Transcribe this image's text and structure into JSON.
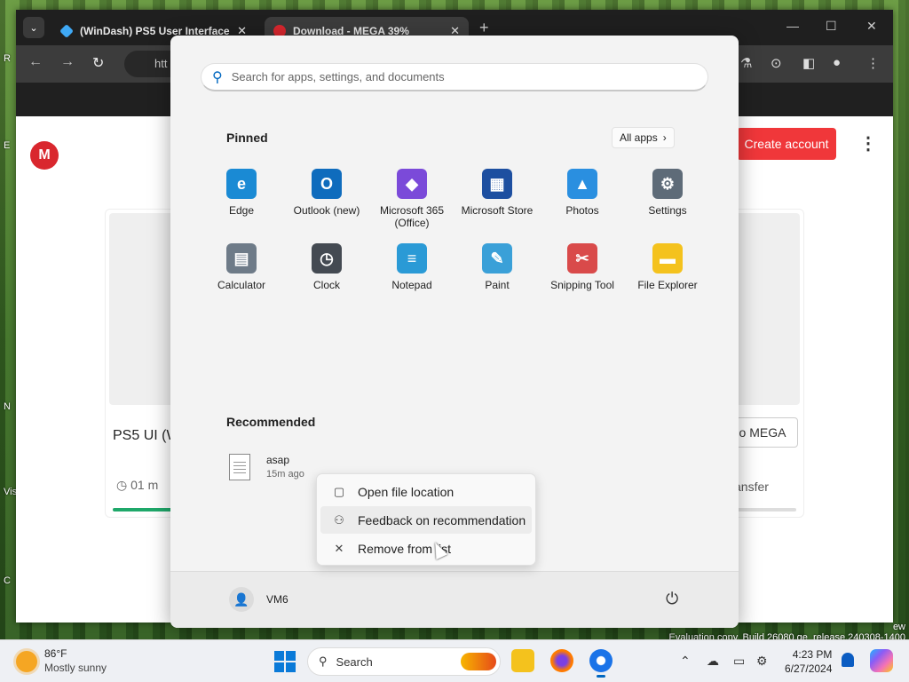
{
  "desktop": {
    "labels": [
      "R",
      "E",
      "N",
      "Vis",
      "C"
    ],
    "eval_line1": "ew",
    "eval_line2": "Evaluation copy. Build 26080.ge_release.240308-1400"
  },
  "browser": {
    "tabs": [
      {
        "title": "(WinDash) PS5 User Interface",
        "favicon_color": "#3fa9f5"
      },
      {
        "title": "Download - MEGA 39%",
        "favicon_color": "#d9272e"
      }
    ],
    "url_fragment": "htt",
    "page": {
      "logo_letter": "M",
      "create_account": "Create account",
      "file_title_partial": "PS5 UI (W",
      "time_left": "01 m",
      "to_mega_partial": "o MEGA",
      "transfer_partial": "ansfer",
      "download_progress": 0.39
    }
  },
  "start_menu": {
    "search_placeholder": "Search for apps, settings, and documents",
    "pinned_heading": "Pinned",
    "all_apps": "All apps",
    "apps": [
      {
        "label": "Edge",
        "icon": "edge-icon",
        "color": "#1a8ad4"
      },
      {
        "label": "Outlook (new)",
        "icon": "outlook-icon",
        "color": "#0f6cbd"
      },
      {
        "label": "Microsoft 365 (Office)",
        "icon": "m365-icon",
        "color": "#7b4ad9"
      },
      {
        "label": "Microsoft Store",
        "icon": "store-icon",
        "color": "#1d4fa0"
      },
      {
        "label": "Photos",
        "icon": "photos-icon",
        "color": "#2a8fe0"
      },
      {
        "label": "Settings",
        "icon": "gear-icon",
        "color": "#5e6b78"
      },
      {
        "label": "Calculator",
        "icon": "calculator-icon",
        "color": "#6e7b88"
      },
      {
        "label": "Clock",
        "icon": "clock-icon",
        "color": "#444a52"
      },
      {
        "label": "Notepad",
        "icon": "notepad-icon",
        "color": "#2a9ad6"
      },
      {
        "label": "Paint",
        "icon": "paint-icon",
        "color": "#3aa0d8"
      },
      {
        "label": "Snipping Tool",
        "icon": "snipping-icon",
        "color": "#d94a4a"
      },
      {
        "label": "File Explorer",
        "icon": "folder-icon",
        "color": "#f4c21d"
      }
    ],
    "recommended_heading": "Recommended",
    "recommended": [
      {
        "name": "asap",
        "time": "15m ago"
      }
    ],
    "context_menu": [
      {
        "label": "Open file location",
        "icon": "folder-open-icon"
      },
      {
        "label": "Feedback on recommendation",
        "icon": "feedback-icon"
      },
      {
        "label": "Remove from list",
        "icon": "close-icon"
      }
    ],
    "user": "VM6"
  },
  "taskbar": {
    "temp": "86°F",
    "condition": "Mostly sunny",
    "search_label": "Search",
    "time": "4:23 PM",
    "date": "6/27/2024"
  }
}
